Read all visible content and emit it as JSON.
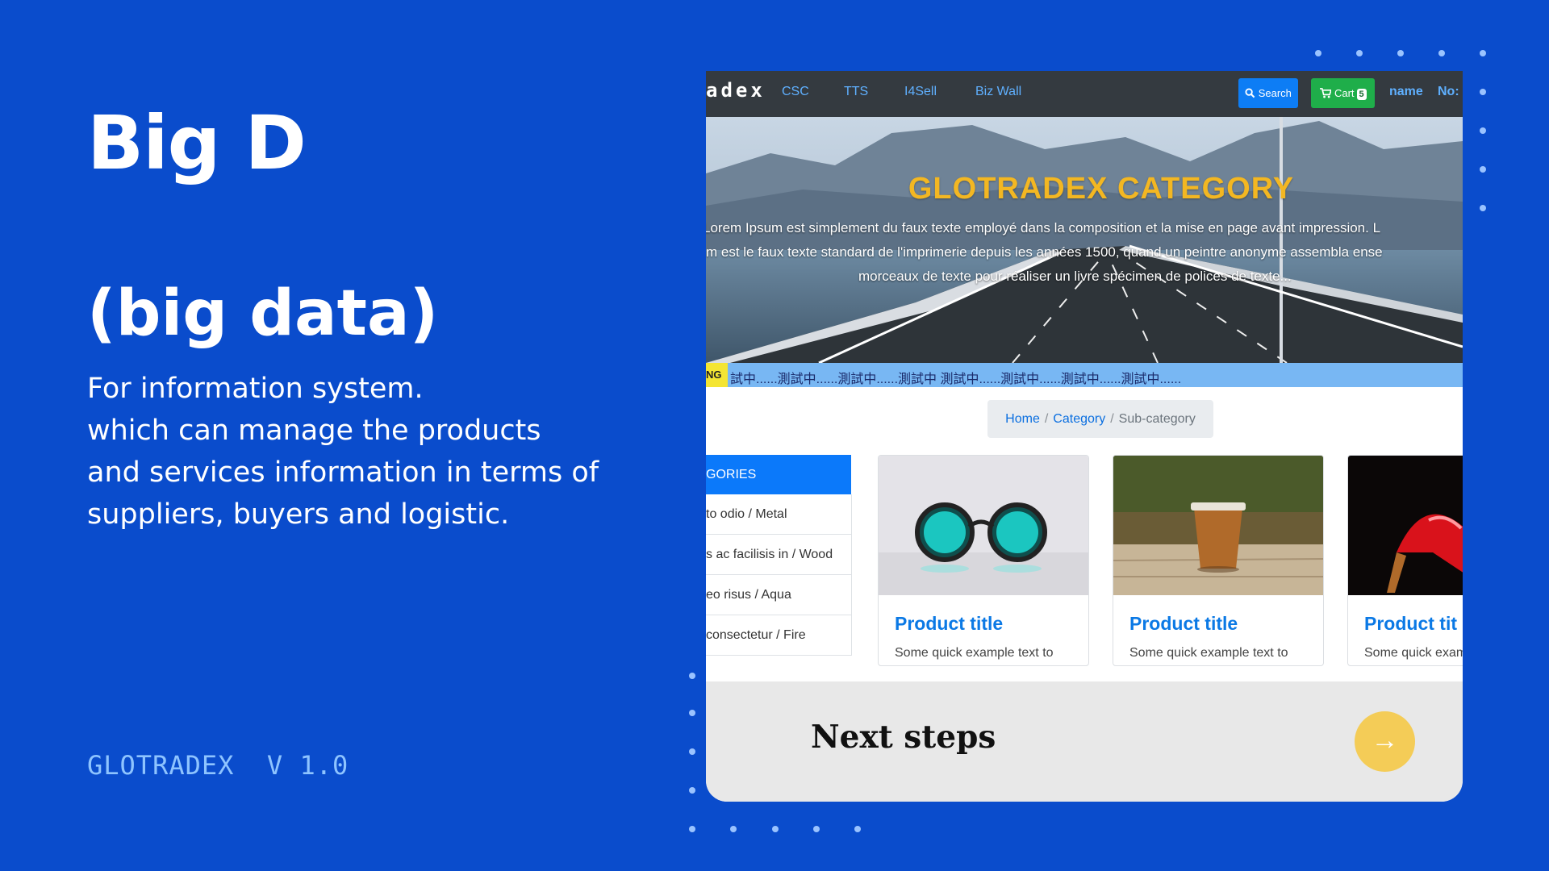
{
  "left": {
    "title": "Big D",
    "subtitle": "(big data)",
    "body": [
      "For information system.",
      "which can manage the products",
      "and services information in terms of",
      "suppliers,  buyers and logistic."
    ],
    "version": "GLOTRADEX  V 1.0"
  },
  "app": {
    "brand": "adex",
    "nav": [
      "CSC",
      "TTS",
      "I4Sell",
      "Biz Wall"
    ],
    "search_label": "Search",
    "search_icon": "search-icon",
    "cart_label": "Cart",
    "cart_icon": "cart-icon",
    "cart_count": "5",
    "user_name": "name",
    "user_no": "No:",
    "hero": {
      "title": "GLOTRADEX CATEGORY",
      "lines": [
        "Lorem Ipsum est simplement du faux texte employé dans la composition et la mise en page avant impression. L",
        "m est le faux texte standard de l'imprimerie depuis les années 1500, quand un peintre anonyme assembla ense",
        "morceaux de texte pour réaliser un livre spécimen de polices de texte..."
      ]
    },
    "ticker": {
      "tag": "NG",
      "text": "試中......測試中......測試中......測試中 測試中......測試中......測試中......測試中......"
    },
    "breadcrumb": {
      "home": "Home",
      "sep": "/",
      "category": "Category",
      "current": "Sub-category"
    },
    "categories": {
      "header": "GORIES",
      "items": [
        "to odio / Metal",
        "s ac facilisis in / Wood",
        "eo risus / Aqua",
        "consectetur / Fire"
      ]
    },
    "products": [
      {
        "title": "Product title",
        "text": "Some quick example text to",
        "image": "sunglasses"
      },
      {
        "title": "Product title",
        "text": "Some quick example text to",
        "image": "coffee-cup"
      },
      {
        "title": "Product tit",
        "text": "Some quick exam",
        "image": "red-high-heel"
      }
    ]
  },
  "cta": {
    "label": "Next steps",
    "arrow": "→",
    "arrow_icon": "arrow-right-icon"
  },
  "colors": {
    "background": "#0a4ccc",
    "dots": "#9ac3ff",
    "navbar": "#343a40",
    "nav_link": "#5fb0ff",
    "search_btn": "#0d7df5",
    "cart_btn": "#1fae4a",
    "hero_title": "#f3b722",
    "ticker": "#78b7f3",
    "category_header": "#0b79fa",
    "product_title": "#0b79e5",
    "cta_panel": "#e8e8e8",
    "cta_button": "#f4cc57"
  }
}
